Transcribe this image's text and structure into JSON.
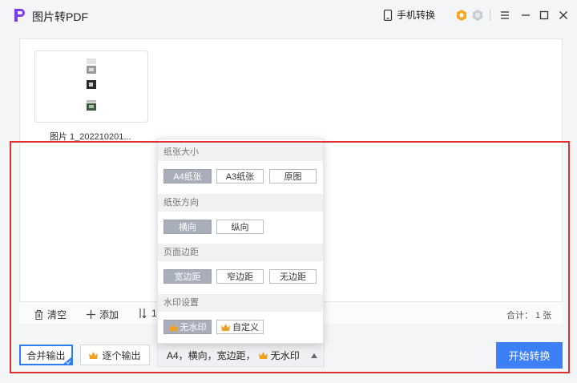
{
  "app": {
    "title": "图片转PDF"
  },
  "header": {
    "mobile_label": "手机转换"
  },
  "file": {
    "name": "图片 1_202210201..."
  },
  "toolbar": {
    "clear_label": "清空",
    "add_label": "添加",
    "sort_label": "1",
    "count_text": "合计： 1 张"
  },
  "actions": {
    "merge_label": "合并输出",
    "each_label": "逐个输出",
    "settings_value": "A4，横向，宽边距，",
    "watermark_value": "无水印",
    "start_label": "开始转换"
  },
  "popup": {
    "paper_size": {
      "title": "纸张大小",
      "options": [
        "A4纸张",
        "A3纸张",
        "原图"
      ],
      "selected": "A4纸张"
    },
    "orientation": {
      "title": "纸张方向",
      "options": [
        "横向",
        "纵向"
      ],
      "selected": "横向"
    },
    "margin": {
      "title": "页面边距",
      "options": [
        "宽边距",
        "窄边距",
        "无边距"
      ],
      "selected": "宽边距"
    },
    "watermark": {
      "title": "水印设置",
      "options": [
        "无水印",
        "自定义"
      ],
      "selected": "无水印"
    }
  },
  "colors": {
    "accent": "#3d7ff6",
    "selected_option": "#a9aebb",
    "highlight": "#e03030",
    "crown": "#f0a020"
  },
  "icons": [
    "app-logo-icon",
    "phone-icon",
    "vip-gold-icon",
    "vip-gray-icon",
    "menu-icon",
    "minimize-icon",
    "maximize-icon",
    "close-icon",
    "trash-icon",
    "plus-icon",
    "sort-icon",
    "crown-icon",
    "dropdown-arrow-icon"
  ]
}
